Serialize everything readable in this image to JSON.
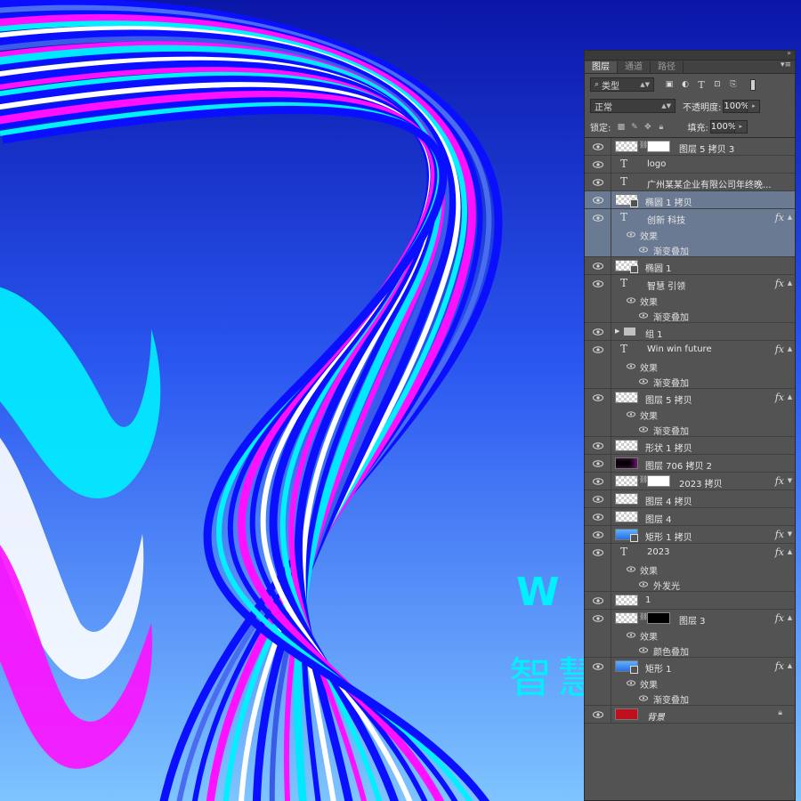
{
  "canvas": {
    "headline_letter": "W",
    "headline_cn": "智慧"
  },
  "panel": {
    "tabs": [
      {
        "label": "图层",
        "active": true
      },
      {
        "label": "通道",
        "active": false
      },
      {
        "label": "路径",
        "active": false
      }
    ],
    "filter": {
      "kind_label": "类型"
    },
    "blend_mode": "正常",
    "opacity_label": "不透明度:",
    "opacity_value": "100%",
    "lock_label": "锁定:",
    "fill_label": "填充:",
    "fill_value": "100%"
  },
  "layers": [
    {
      "name": "图层 5 拷贝 3",
      "kind": "pixel_masked",
      "visible": true
    },
    {
      "name": "logo",
      "kind": "text",
      "visible": true
    },
    {
      "name": "广州某某企业有限公司年终晚...",
      "kind": "text",
      "visible": true
    },
    {
      "name": "椭圆 1 拷贝",
      "kind": "shape",
      "visible": true,
      "selected": true
    },
    {
      "name": "创新 科技",
      "kind": "text",
      "visible": true,
      "fx": true,
      "selected": true,
      "effects_label": "效果",
      "effects": [
        "渐变叠加"
      ]
    },
    {
      "name": "椭圆 1",
      "kind": "shape",
      "visible": true
    },
    {
      "name": "智慧 引领",
      "kind": "text",
      "visible": true,
      "fx": true,
      "effects_label": "效果",
      "effects": [
        "渐变叠加"
      ]
    },
    {
      "name": "组 1",
      "kind": "group",
      "visible": true
    },
    {
      "name": "Win win future",
      "kind": "text",
      "visible": true,
      "fx": true,
      "effects_label": "效果",
      "effects": [
        "渐变叠加"
      ]
    },
    {
      "name": "图层 5 拷贝",
      "kind": "pixel",
      "visible": true,
      "fx": true,
      "effects_label": "效果",
      "effects": [
        "渐变叠加"
      ]
    },
    {
      "name": "形状 1 拷贝",
      "kind": "pixel",
      "visible": true
    },
    {
      "name": "图层 706 拷贝 2",
      "kind": "pixel_dark",
      "visible": true
    },
    {
      "name": "2023 拷贝",
      "kind": "pixel_masked",
      "visible": true,
      "fx": true
    },
    {
      "name": "图层 4 拷贝",
      "kind": "pixel",
      "visible": true
    },
    {
      "name": "图层 4",
      "kind": "pixel",
      "visible": true
    },
    {
      "name": "矩形 1 拷贝",
      "kind": "shape_blue",
      "visible": true,
      "fx": true
    },
    {
      "name": "2023",
      "kind": "text",
      "visible": true,
      "fx": true,
      "effects_label": "效果",
      "effects": [
        "外发光"
      ]
    },
    {
      "name": "1",
      "kind": "pixel",
      "visible": true
    },
    {
      "name": "图层 3",
      "kind": "pixel_masked_dark",
      "visible": true,
      "fx": true,
      "effects_label": "效果",
      "effects": [
        "颜色叠加"
      ]
    },
    {
      "name": "矩形 1",
      "kind": "shape_blue",
      "visible": true,
      "fx": true,
      "effects_label": "效果",
      "effects": [
        "渐变叠加"
      ]
    },
    {
      "name": "背景",
      "kind": "background",
      "visible": true,
      "locked": true
    }
  ],
  "colors": {
    "panel_bg": "#535353",
    "selection": "#6b7a93",
    "canvas_top": "#0b1bb0",
    "canvas_bottom": "#7ec4ff",
    "headline": "#00f0ff",
    "background_swatch": "#c0101e"
  }
}
